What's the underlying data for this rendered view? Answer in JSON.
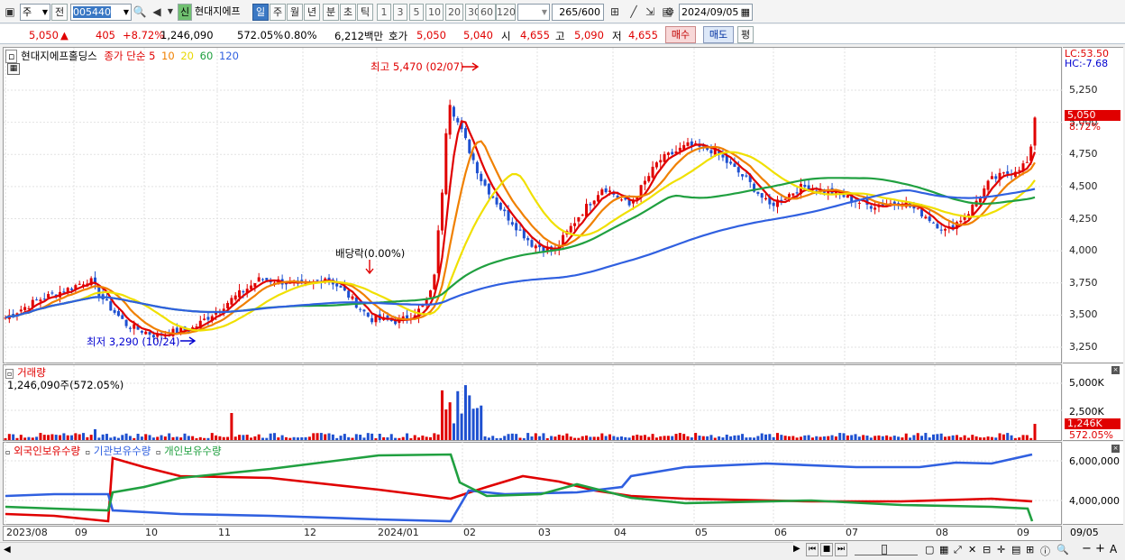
{
  "toolbar": {
    "market": "주",
    "prev": "전",
    "code": "005440",
    "new_badge": "신",
    "name": "현대지에프",
    "periods": [
      "일",
      "주",
      "월",
      "년",
      "분",
      "초",
      "틱"
    ],
    "intervals": [
      "1",
      "3",
      "5",
      "10",
      "20",
      "30",
      "60",
      "120"
    ],
    "count": "265",
    "count_total": "/600",
    "date": "2024/09/05"
  },
  "quote": {
    "price": "5,050",
    "arrow": "▲",
    "change": "405",
    "change_rate": "+8.72%",
    "volume": "1,246,090",
    "volume_ratio": "572.05%",
    "turnover": "0.80%",
    "amount": "6,212백만",
    "ask_label": "호가",
    "ask1": "5,050",
    "ask2": "5,040",
    "open_label": "시",
    "open": "4,655",
    "high_label": "고",
    "high": "5,090",
    "low_label": "저",
    "low": "4,655",
    "buy": "매수",
    "sell": "매도",
    "avg": "평"
  },
  "price_panel": {
    "stock": "현대지에프홀딩스",
    "legend_type": "종가 단순",
    "ma_periods": [
      "5",
      "10",
      "20",
      "60",
      "120"
    ],
    "ma_colors": [
      "#e00000",
      "#f08000",
      "#f0e000",
      "#20a040",
      "#3060e0"
    ],
    "lc": "LC:53.50",
    "hc": "HC:-7.68",
    "high_marker": "최고 5,470 (02/07)",
    "low_marker": "최저 3,290 (10/24)",
    "dividend_marker": "배당락(0.00%)",
    "last_tag": "5,050",
    "last_pct": "8.72%",
    "y_ticks": [
      "5,250",
      "5,000",
      "4,750",
      "4,500",
      "4,250",
      "4,000",
      "3,750",
      "3,500",
      "3,250"
    ]
  },
  "volume_panel": {
    "title": "거래량",
    "value": "1,246,090주(572.05%)",
    "y_ticks": [
      "5,000K",
      "2,500K"
    ],
    "last_tag": "1,246K",
    "last_pct": "572.05%"
  },
  "holding_panel": {
    "series": [
      "외국인보유수량",
      "기관보유수량",
      "개인보유수량"
    ],
    "colors": [
      "#e00000",
      "#3060e0",
      "#20a040"
    ],
    "y_ticks": [
      "6,000,000",
      "4,000,000"
    ]
  },
  "x_labels": [
    "2023/08",
    "09",
    "10",
    "11",
    "12",
    "2024/01",
    "02",
    "03",
    "04",
    "05",
    "06",
    "07",
    "08",
    "09"
  ],
  "x_right": "09/05",
  "status_icons": [
    "play-icon",
    "rewind-icon",
    "stop-icon",
    "fast-forward-icon",
    "zoom-in-icon",
    "zoom-out-icon",
    "font-icon"
  ]
}
